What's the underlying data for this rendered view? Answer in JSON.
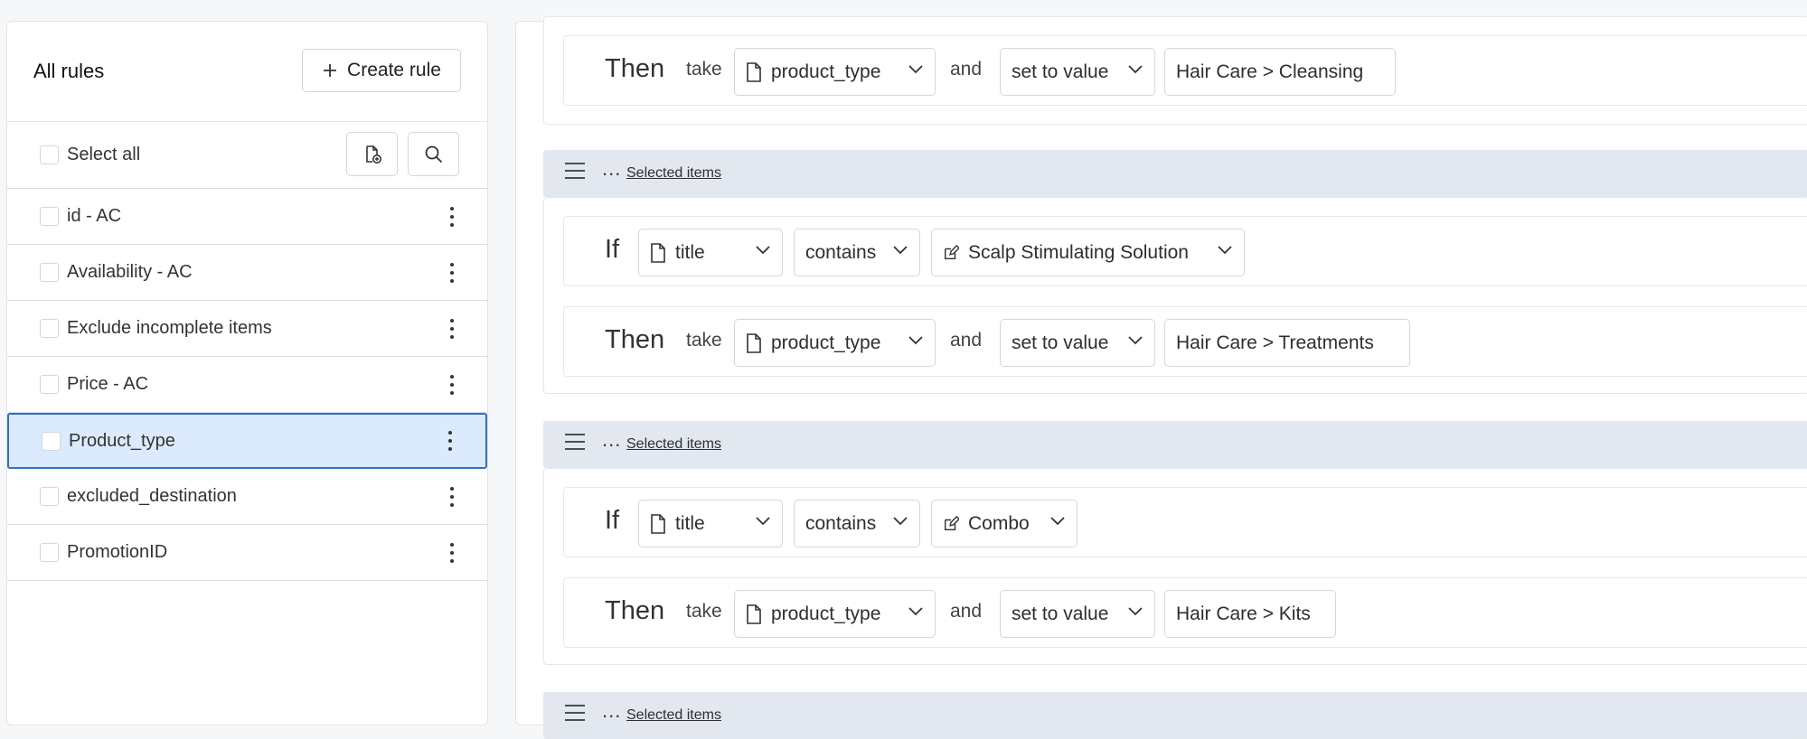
{
  "sidebar": {
    "title": "All rules",
    "create_label": "Create rule",
    "select_all_label": "Select all",
    "rules": [
      {
        "label": "id - AC",
        "selected": false
      },
      {
        "label": "Availability - AC",
        "selected": false
      },
      {
        "label": "Exclude incomplete items",
        "selected": false
      },
      {
        "label": "Price - AC",
        "selected": false
      },
      {
        "label": "Product_type",
        "selected": true
      },
      {
        "label": "excluded_destination",
        "selected": false
      },
      {
        "label": "PromotionID",
        "selected": false
      }
    ]
  },
  "editor": {
    "selected_items_label": "Selected items",
    "dots": "...",
    "if_label": "If",
    "then_label": "Then",
    "take_label": "take",
    "and_label": "and",
    "groups": [
      {
        "then": {
          "field": "product_type",
          "action": "set to value",
          "value": "Hair Care > Cleansing"
        }
      },
      {
        "if": {
          "field": "title",
          "operator": "contains",
          "value": "Scalp Stimulating Solution"
        },
        "then": {
          "field": "product_type",
          "action": "set to value",
          "value": "Hair Care > Treatments"
        }
      },
      {
        "if": {
          "field": "title",
          "operator": "contains",
          "value": "Combo"
        },
        "then": {
          "field": "product_type",
          "action": "set to value",
          "value": "Hair Care > Kits"
        }
      }
    ]
  },
  "icons": {
    "plus": "plus-icon",
    "add_file": "file-add-icon",
    "search": "search-icon",
    "kebab": "kebab-menu-icon",
    "drag": "drag-handle-icon",
    "file": "file-icon",
    "edit": "edit-icon",
    "chevron": "chevron-down-icon"
  },
  "colors": {
    "selected_bg": "#dbeafc",
    "selected_border": "#2a73bf",
    "group_header_bg": "#e3e8f0"
  }
}
